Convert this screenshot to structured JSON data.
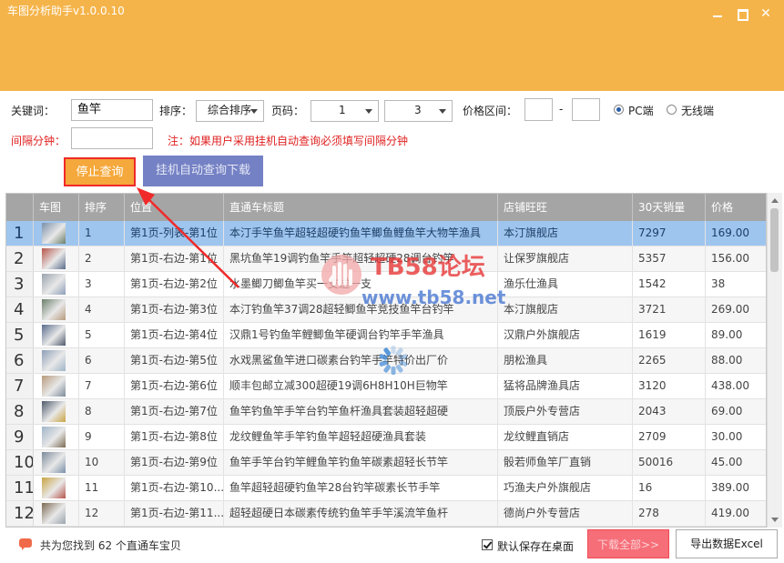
{
  "window": {
    "title": "车图分析助手v1.0.0.10"
  },
  "form": {
    "keyword_label": "关键词：",
    "keyword_value": "鱼竿",
    "sort_label": "排序：",
    "sort_value": "综合排序",
    "page_label": "页码：",
    "page_from": "1",
    "page_to": "3",
    "price_label": "价格区间：",
    "price_sep": "-",
    "radio_pc": "PC端",
    "radio_wireless": "无线端",
    "interval_label": "间隔分钟：",
    "notice": "注：如果用户采用挂机自动查询必须填写间隔分钟"
  },
  "buttons": {
    "stop": "停止查询",
    "auto": "挂机自动查询下载",
    "next": "下载全部>>",
    "export": "导出数据Excel"
  },
  "table": {
    "headers": [
      "车图",
      "排序",
      "位置",
      "直通车标题",
      "店铺旺旺",
      "30天销量",
      "价格"
    ],
    "rows": [
      {
        "n": "1",
        "rank": "1",
        "pos": "第1页-列表-第1位",
        "title": "本汀手竿鱼竿超轻超硬钓鱼竿鲫鱼鲤鱼竿大物竿渔具",
        "shop": "本汀旗舰店",
        "sales": "7297",
        "price": "169.00"
      },
      {
        "n": "2",
        "rank": "2",
        "pos": "第1页-右边-第1位",
        "title": "黑坑鱼竿19调钓鱼竿手竿超轻超硬28调台钓竿",
        "shop": "让保罗旗舰店",
        "sales": "5357",
        "price": "156.00"
      },
      {
        "n": "3",
        "rank": "3",
        "pos": "第1页-右边-第2位",
        "title": "水墨鲫刀鲫鱼竿买一支送一支",
        "shop": "渔乐仕渔具",
        "sales": "1542",
        "price": "38"
      },
      {
        "n": "4",
        "rank": "4",
        "pos": "第1页-右边-第3位",
        "title": "本汀钓鱼竿37调28超轻鲫鱼竿竞技鱼竿台钓竿",
        "shop": "本汀旗舰店",
        "sales": "3721",
        "price": "269.00"
      },
      {
        "n": "5",
        "rank": "5",
        "pos": "第1页-右边-第4位",
        "title": "汉鼎1号钓鱼竿鲤鲫鱼竿硬调台钓竿手竿渔具",
        "shop": "汉鼎户外旗舰店",
        "sales": "1619",
        "price": "89.00"
      },
      {
        "n": "6",
        "rank": "6",
        "pos": "第1页-右边-第5位",
        "title": "水戏黑鲨鱼竿进口碳素台钓竿手竿特价出厂价",
        "shop": "朋松渔具",
        "sales": "2265",
        "price": "88.00"
      },
      {
        "n": "7",
        "rank": "7",
        "pos": "第1页-右边-第6位",
        "title": "顺丰包邮立减300超硬19调6H8H10H巨物竿",
        "shop": "猛将品牌渔具店",
        "sales": "3120",
        "price": "438.00"
      },
      {
        "n": "8",
        "rank": "8",
        "pos": "第1页-右边-第7位",
        "title": "鱼竿钓鱼竿手竿台钓竿鱼杆渔具套装超轻超硬",
        "shop": "顶辰户外专营店",
        "sales": "2043",
        "price": "69.00"
      },
      {
        "n": "9",
        "rank": "9",
        "pos": "第1页-右边-第8位",
        "title": "龙纹鲤鱼竿手竿钓鱼竿超轻超硬渔具套装",
        "shop": "龙纹鲤直销店",
        "sales": "2709",
        "price": "30.00"
      },
      {
        "n": "10",
        "rank": "10",
        "pos": "第1页-右边-第9位",
        "title": "鱼竿手竿台钓竿鲤鱼竿钓鱼竿碳素超轻长节竿",
        "shop": "骰若师鱼竿厂直销",
        "sales": "50016",
        "price": "45.00"
      },
      {
        "n": "11",
        "rank": "11",
        "pos": "第1页-右边-第10...",
        "title": "鱼竿超轻超硬钓鱼竿28台钓竿碳素长节手竿",
        "shop": "巧渔夫户外旗舰店",
        "sales": "16",
        "price": "389.00"
      },
      {
        "n": "12",
        "rank": "12",
        "pos": "第1页-右边-第11...",
        "title": "超轻超硬日本碳素传统钓鱼竿手竿溪流竿鱼杆",
        "shop": "德尚户外专营店",
        "sales": "278",
        "price": "419.00"
      }
    ]
  },
  "footer": {
    "status": "共为您找到 62 个直通车宝贝",
    "save_desktop": "默认保存在桌面"
  },
  "watermark": {
    "brand": "TB58论坛",
    "url": "www.tb58.net"
  },
  "colors": {
    "header_bg": "#f5b44a",
    "stop_btn": "#f5a83b",
    "auto_btn": "#7481c4",
    "selected_row": "#9ec5ee",
    "highlight_red": "#f02a2a"
  }
}
